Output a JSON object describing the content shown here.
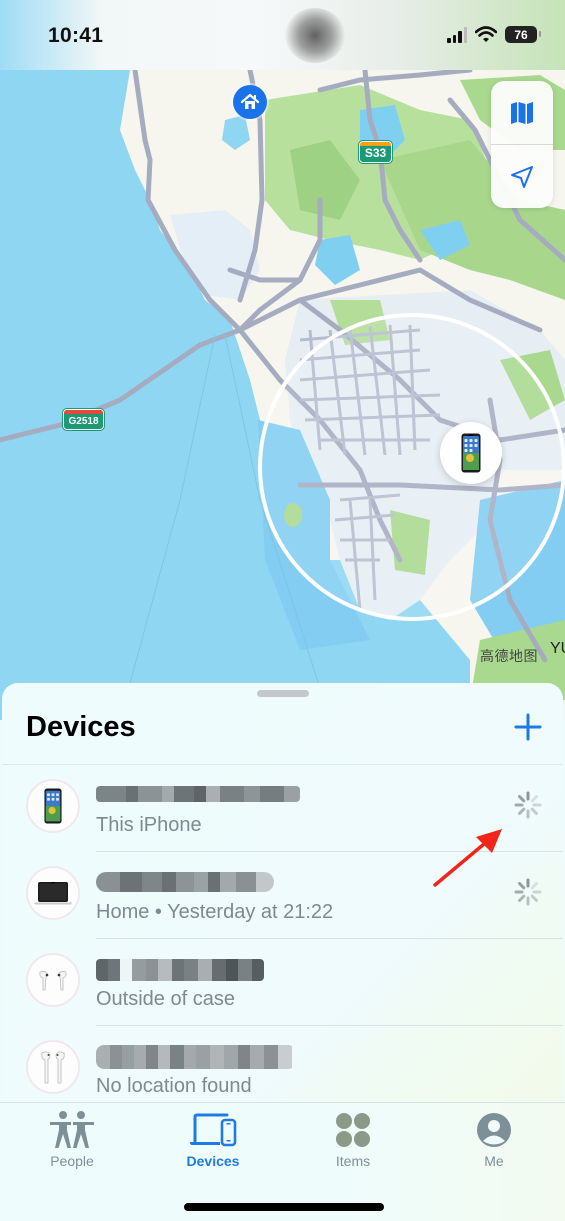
{
  "status_bar": {
    "time": "10:41",
    "battery": "76",
    "signal_icon": "cellular-signal-icon",
    "wifi_icon": "wifi-icon"
  },
  "map": {
    "controls": [
      {
        "name": "map-mode-button",
        "icon": "map-icon"
      },
      {
        "name": "locate-button",
        "icon": "location-arrow-icon"
      }
    ],
    "shields": {
      "s33": "S33",
      "g2518": "G2518"
    },
    "attribution": "高德地图",
    "edge_label": "YU",
    "home_pin_icon": "house-icon",
    "device_pin_icon": "iphone-icon"
  },
  "sheet": {
    "title": "Devices",
    "add_icon": "plus-icon",
    "devices": [
      {
        "status": "This iPhone",
        "icon": "iphone-icon",
        "name_redacted": true,
        "spinner": true
      },
      {
        "status": "Home • Yesterday at 21:22",
        "icon": "macbook-icon",
        "name_redacted": true,
        "spinner": true
      },
      {
        "status": "Outside of case",
        "icon": "airpods-pro-icon",
        "name_redacted": true,
        "spinner": false
      },
      {
        "status": "No location found",
        "icon": "airpods-icon",
        "name_redacted": true,
        "spinner": false
      }
    ]
  },
  "tabbar": {
    "tabs": [
      {
        "label": "People",
        "icon": "people-icon",
        "active": false
      },
      {
        "label": "Devices",
        "icon": "devices-icon",
        "active": true
      },
      {
        "label": "Items",
        "icon": "items-icon",
        "active": false
      },
      {
        "label": "Me",
        "icon": "person-circle-icon",
        "active": false
      }
    ]
  },
  "colors": {
    "accent": "#1E7BE4",
    "water": "#8FD6F3",
    "land": "#F6F5EE",
    "park": "#A9D98E",
    "road": "#A5ACC0",
    "annotation_arrow": "#F0261B"
  }
}
